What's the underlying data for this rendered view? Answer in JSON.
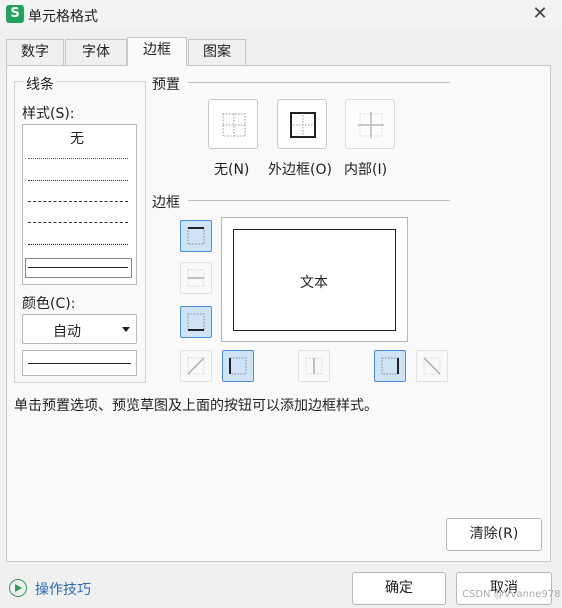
{
  "window": {
    "title": "单元格格式",
    "app_icon_letter": "S",
    "close_symbol": "✕"
  },
  "tabs": [
    {
      "label": "数字",
      "active": false
    },
    {
      "label": "字体",
      "active": false
    },
    {
      "label": "边框",
      "active": true
    },
    {
      "label": "图案",
      "active": false
    }
  ],
  "line": {
    "group_label": "线条",
    "style_label": "样式(S):",
    "none_label": "无",
    "color_label": "颜色(C):",
    "color_value": "自动",
    "selected_style": "thin solid"
  },
  "presets": {
    "section_label": "预置",
    "items": [
      {
        "label": "无(N)",
        "icon": "border-none-icon"
      },
      {
        "label": "外边框(O)",
        "icon": "border-outline-icon"
      },
      {
        "label": "内部(I)",
        "icon": "border-inside-icon"
      }
    ]
  },
  "border": {
    "section_label": "边框",
    "preview_text": "文本"
  },
  "hint": "单击预置选项、预览草图及上面的按钮可以添加边框样式。",
  "clear_button": "清除(R)",
  "footer": {
    "tips_label": "操作技巧",
    "ok_button": "确定",
    "cancel_button": "取消"
  },
  "watermark": "CSDN @Vvanne978",
  "colors": {
    "accent": "#4a90d9",
    "toggle_on_bg": "#cfe3f6",
    "app_icon": "#22a35a",
    "link": "#2b6cb0"
  }
}
